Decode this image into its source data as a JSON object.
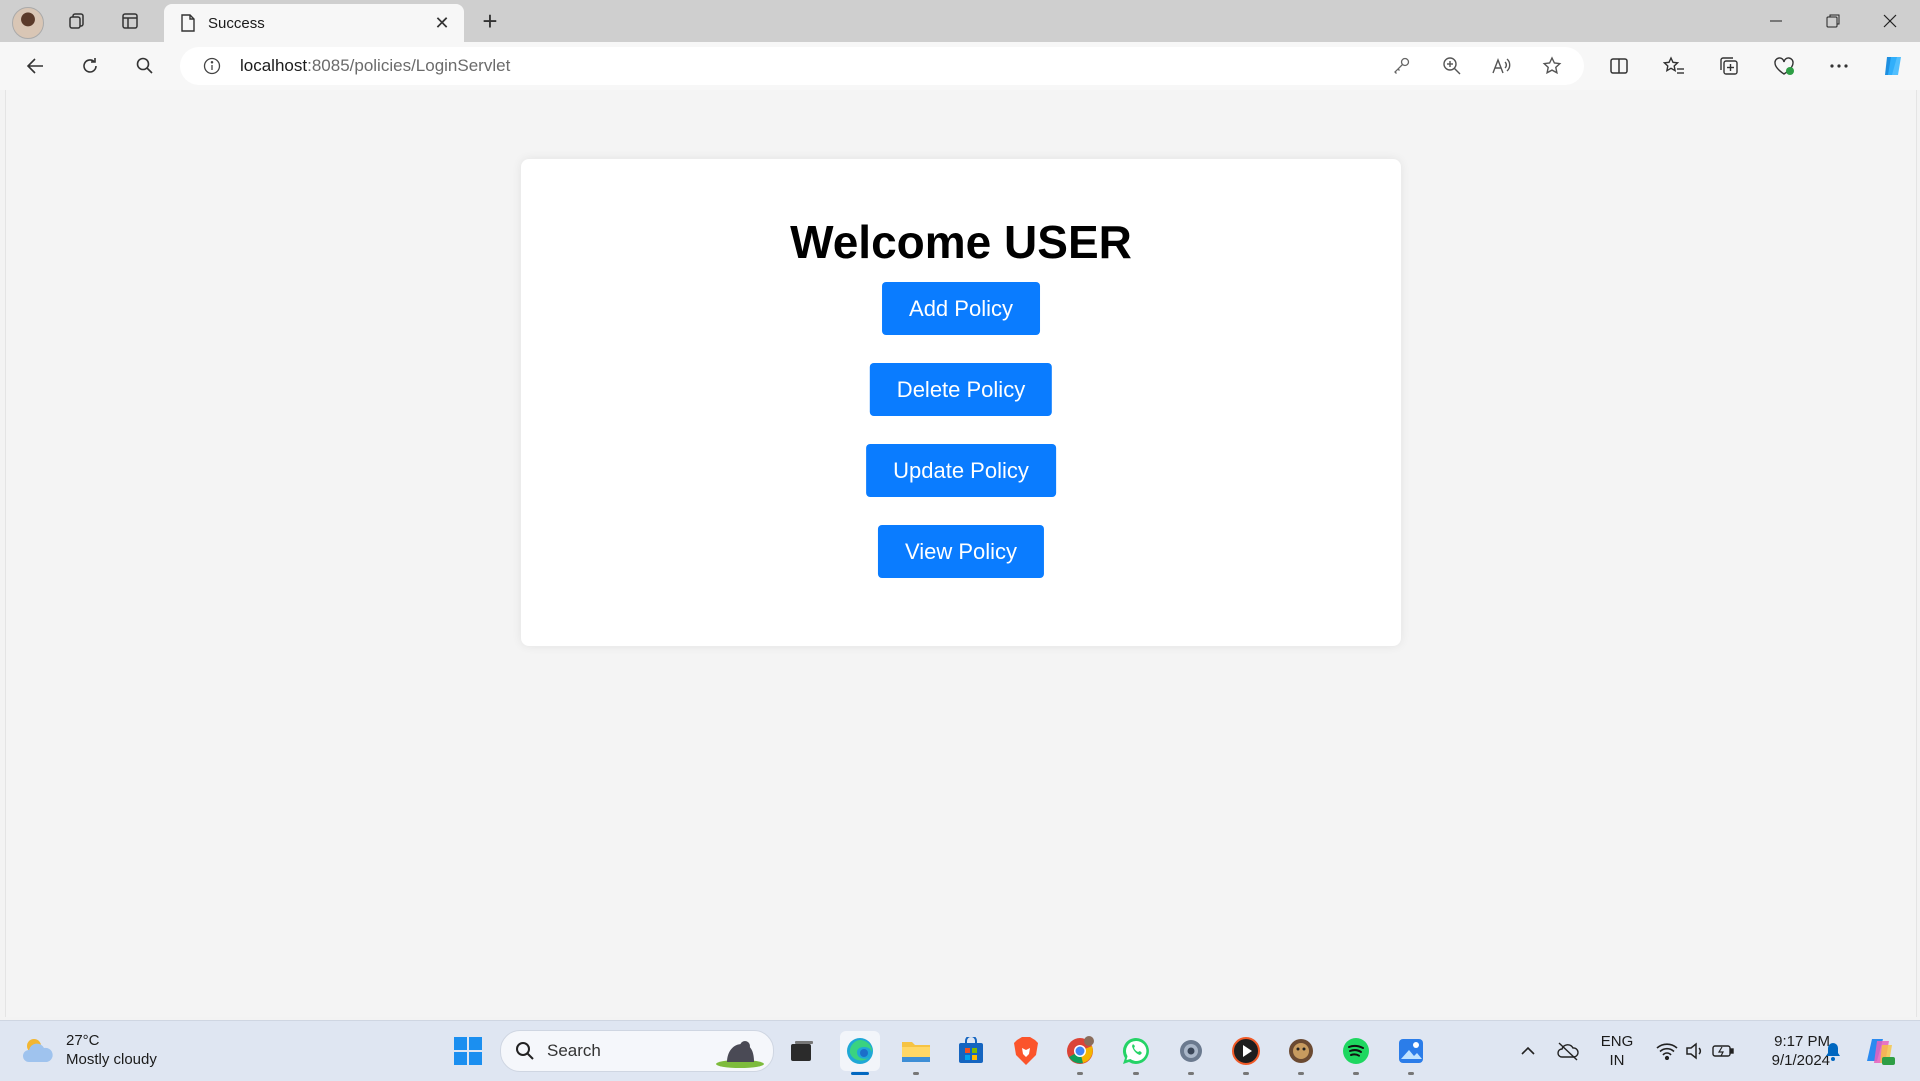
{
  "browser": {
    "tab": {
      "title": "Success"
    },
    "address": {
      "host": "localhost",
      "rest": ":8085/policies/LoginServlet"
    }
  },
  "page": {
    "heading": "Welcome USER",
    "buttons": {
      "add": "Add Policy",
      "delete": "Delete Policy",
      "update": "Update Policy",
      "view": "View Policy"
    }
  },
  "taskbar": {
    "weather": {
      "temp": "27°C",
      "condition": "Mostly cloudy"
    },
    "search_label": "Search",
    "language": {
      "lang": "ENG",
      "region": "IN"
    },
    "clock": {
      "time": "9:17 PM",
      "date": "9/1/2024"
    },
    "apps": [
      "windows-start-icon",
      "search",
      "task-view-icon",
      "edge-icon",
      "file-explorer-icon",
      "microsoft-store-icon",
      "brave-icon",
      "chrome-icon",
      "whatsapp-icon",
      "settings-icon",
      "media-player-icon",
      "app-icon",
      "spotify-icon",
      "photos-icon"
    ]
  },
  "colors": {
    "accent": "#0a7cff",
    "taskbar": "#dfe6f2"
  }
}
